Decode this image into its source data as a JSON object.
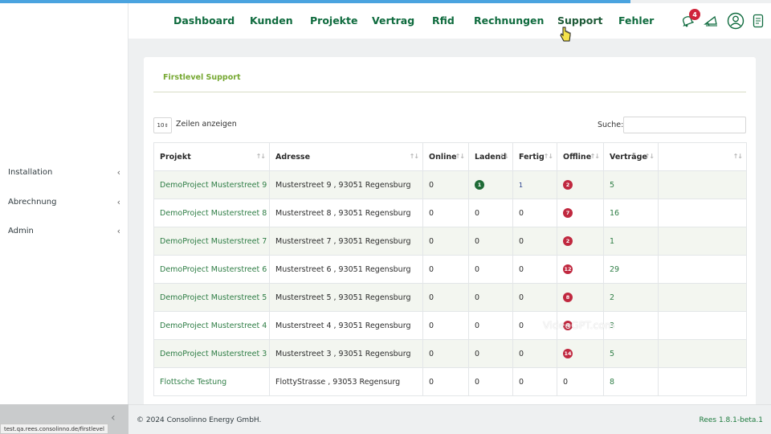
{
  "nav": {
    "items": [
      "Dashboard",
      "Kunden",
      "Projekte",
      "Vertrag",
      "Rfid",
      "Rechnungen",
      "Support",
      "Fehler"
    ],
    "notification_count": "4",
    "icons": [
      "bell-icon",
      "megaphone-icon",
      "user-circle-icon",
      "document-icon"
    ]
  },
  "sidebar": {
    "items": [
      {
        "label": "Installation"
      },
      {
        "label": "Abrechnung"
      },
      {
        "label": "Admin"
      }
    ]
  },
  "card": {
    "title": "Firstlevel Support",
    "length_value": "10",
    "length_label": "Zeilen anzeigen",
    "search_label": "Suche:",
    "search_value": ""
  },
  "table": {
    "headers": [
      "Projekt",
      "Adresse",
      "Online",
      "Ladend",
      "Fertig",
      "Offline",
      "Verträge",
      ""
    ],
    "rows": [
      {
        "projekt": "DemoProject Musterstreet 9",
        "adresse": "Musterstreet 9 , 93051 Regensburg",
        "online": "0",
        "ladend": "1",
        "fertig": "1",
        "offline": "2",
        "vertraege": "5"
      },
      {
        "projekt": "DemoProject Musterstreet 8",
        "adresse": "Musterstreet 8 , 93051 Regensburg",
        "online": "0",
        "ladend": "0",
        "fertig": "0",
        "offline": "7",
        "vertraege": "16"
      },
      {
        "projekt": "DemoProject Musterstreet 7",
        "adresse": "Musterstreet 7 , 93051 Regensburg",
        "online": "0",
        "ladend": "0",
        "fertig": "0",
        "offline": "2",
        "vertraege": "1"
      },
      {
        "projekt": "DemoProject Musterstreet 6",
        "adresse": "Musterstreet 6 , 93051 Regensburg",
        "online": "0",
        "ladend": "0",
        "fertig": "0",
        "offline": "12",
        "vertraege": "29"
      },
      {
        "projekt": "DemoProject Musterstreet 5",
        "adresse": "Musterstreet 5 , 93051 Regensburg",
        "online": "0",
        "ladend": "0",
        "fertig": "0",
        "offline": "8",
        "vertraege": "2"
      },
      {
        "projekt": "DemoProject Musterstreet 4",
        "adresse": "Musterstreet 4 , 93051 Regensburg",
        "online": "0",
        "ladend": "0",
        "fertig": "0",
        "offline": "4",
        "vertraege": "3"
      },
      {
        "projekt": "DemoProject Musterstreet 3",
        "adresse": "Musterstreet 3 , 93051 Regensburg",
        "online": "0",
        "ladend": "0",
        "fertig": "0",
        "offline": "14",
        "vertraege": "5"
      },
      {
        "projekt": "Flottsche Testung",
        "adresse": "FlottyStrasse , 93053 Regensurg",
        "online": "0",
        "ladend": "0",
        "fertig": "0",
        "offline": "0",
        "vertraege": "8"
      }
    ]
  },
  "watermark": "VideoGPT.com",
  "footer": {
    "left": "© 2024 Consolinno Energy GmbH.",
    "right": "Rees 1.8.1-beta.1"
  },
  "status_url": "test.qa.rees.consolinno.de/firstlevel",
  "colors": {
    "nav_green": "#0f6b3e",
    "title_green": "#76a832",
    "offline_red": "#c0283f",
    "ladend_green": "#1e6b36",
    "link_green": "#2e7d45"
  }
}
